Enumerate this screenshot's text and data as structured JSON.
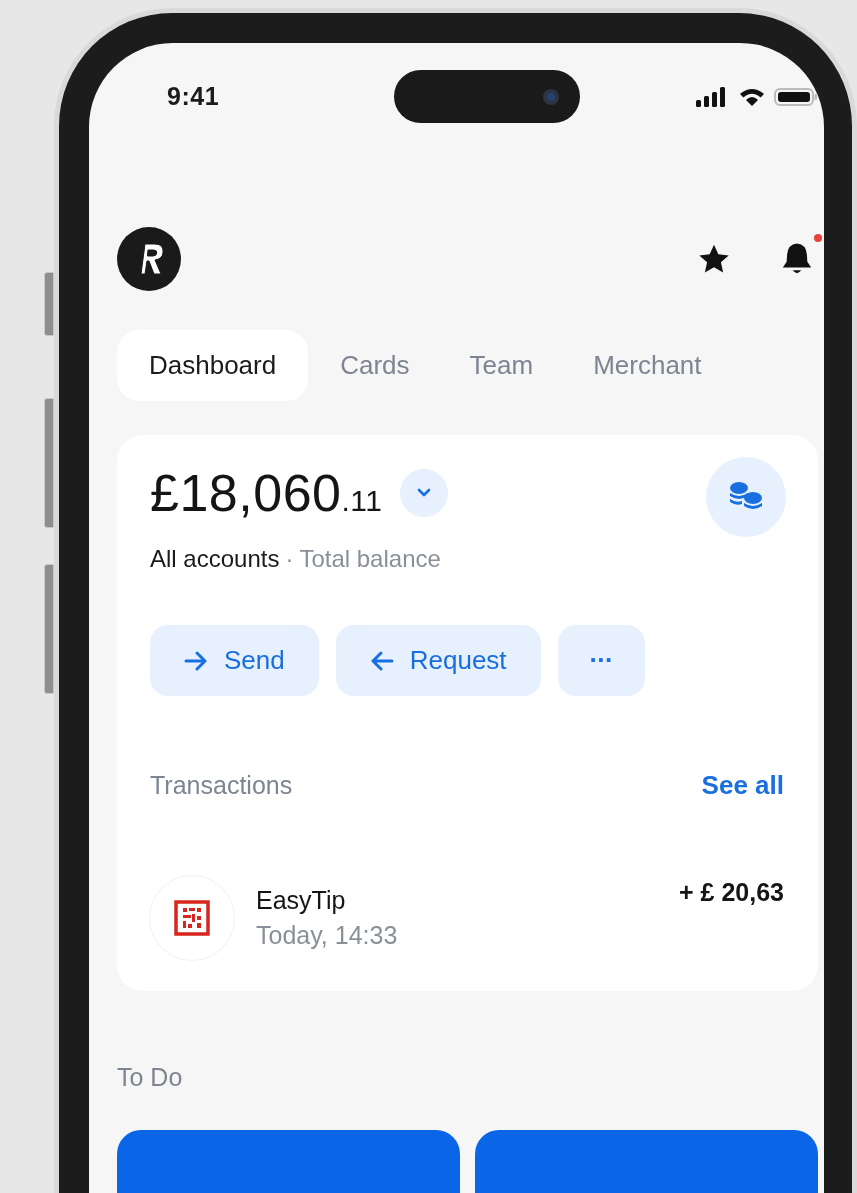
{
  "status_bar": {
    "time": "9:41"
  },
  "header": {
    "notifications": {
      "unread": true
    }
  },
  "tabs": [
    {
      "label": "Dashboard",
      "selected": true
    },
    {
      "label": "Cards",
      "selected": false
    },
    {
      "label": "Team",
      "selected": false
    },
    {
      "label": "Merchant",
      "selected": false
    }
  ],
  "balance": {
    "amount": "£18,060",
    "fraction": ".11",
    "account": "All accounts",
    "separator": "·",
    "caption": "Total balance"
  },
  "actions": [
    {
      "kind": "send",
      "label": "Send"
    },
    {
      "kind": "request",
      "label": "Request"
    },
    {
      "kind": "more",
      "label": "···"
    }
  ],
  "transactions": {
    "title": "Transactions",
    "see_all": "See all",
    "items": [
      {
        "name": "EasyTip",
        "time": "Today, 14:33",
        "amount": "+ £ 20,63"
      }
    ]
  },
  "todo": {
    "title": "To Do",
    "cards": [
      {
        "kind": "task"
      },
      {
        "kind": "task"
      }
    ]
  }
}
